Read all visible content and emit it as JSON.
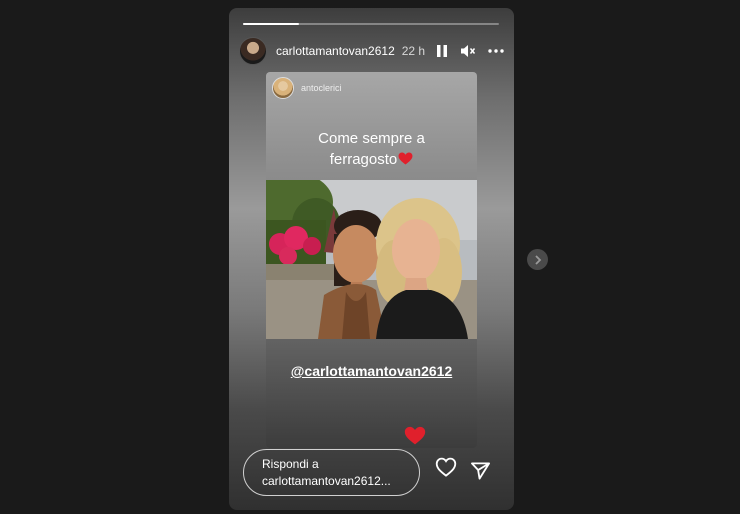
{
  "story": {
    "progress_fraction": 0.22,
    "username": "carlottamantovan2612",
    "time": "22 h",
    "icons": {
      "pause": "pause-icon",
      "mute": "speaker-muted-icon",
      "more": "more-dots-icon"
    },
    "shared_post": {
      "username": "antoclerici",
      "caption_line1": "Come sempre a",
      "caption_line2": "ferragosto",
      "mention": "@carlottamantovan2612"
    },
    "reply": {
      "line1": "Rispondi a",
      "line2": "carlottamantovan2612..."
    }
  },
  "colors": {
    "heart": "#e0202c",
    "background": "#1a1a1a"
  }
}
